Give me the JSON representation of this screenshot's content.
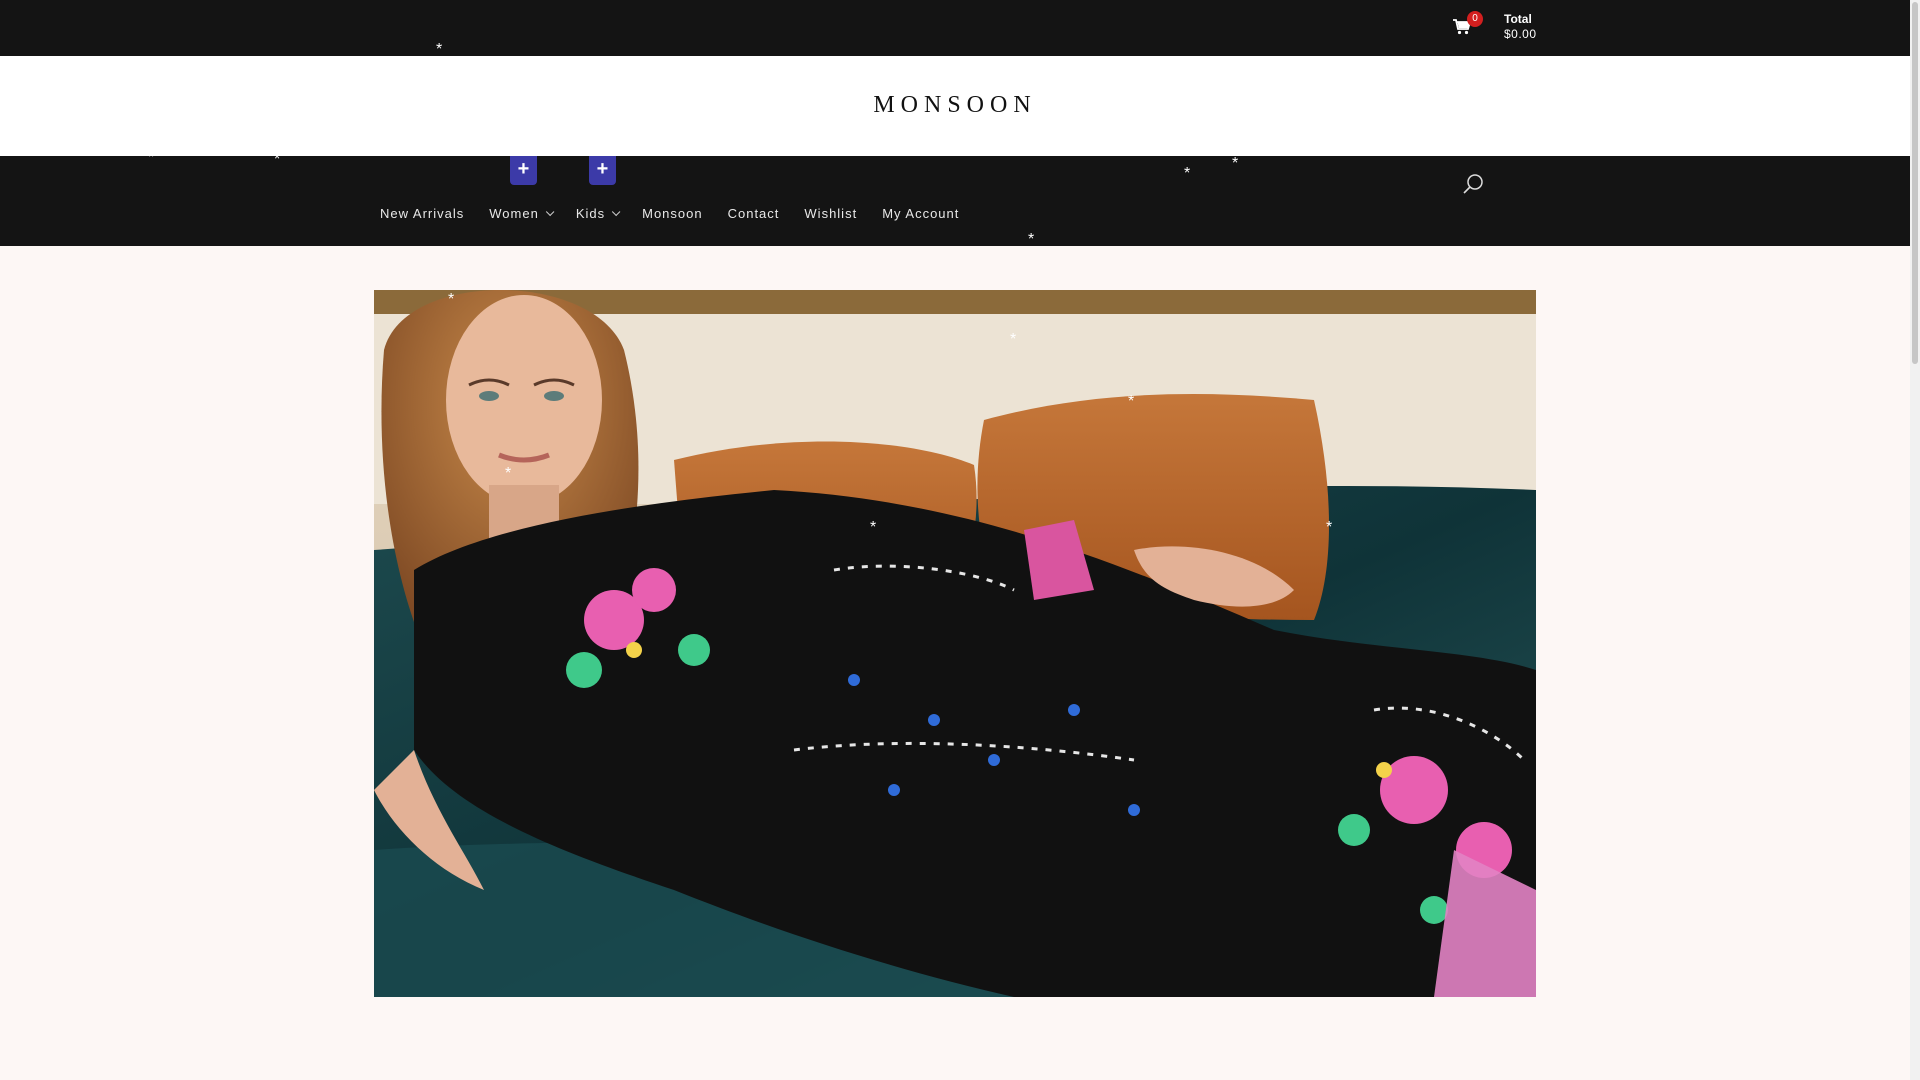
{
  "header": {
    "cart": {
      "count": "0",
      "total_label": "Total",
      "total_value": "$0.00"
    }
  },
  "brand": {
    "logo_text": "MONSOON"
  },
  "nav": {
    "items": [
      {
        "label": "New Arrivals",
        "has_submenu": false
      },
      {
        "label": "Women",
        "has_submenu": true
      },
      {
        "label": "Kids",
        "has_submenu": true
      },
      {
        "label": "Monsoon",
        "has_submenu": false
      },
      {
        "label": "Contact",
        "has_submenu": false
      },
      {
        "label": "Wishlist",
        "has_submenu": false
      },
      {
        "label": "My Account",
        "has_submenu": false
      }
    ],
    "expand_symbol": "+"
  },
  "icons": {
    "cart": "shopping-cart-icon",
    "search": "search-icon",
    "chevron": "chevron-down-icon"
  },
  "colors": {
    "topbar": "#141414",
    "logo_band": "#ffffff",
    "page_bg": "#fdf7f5",
    "cart_badge": "#d31f1f",
    "expand_button": "#3c3aa8"
  }
}
